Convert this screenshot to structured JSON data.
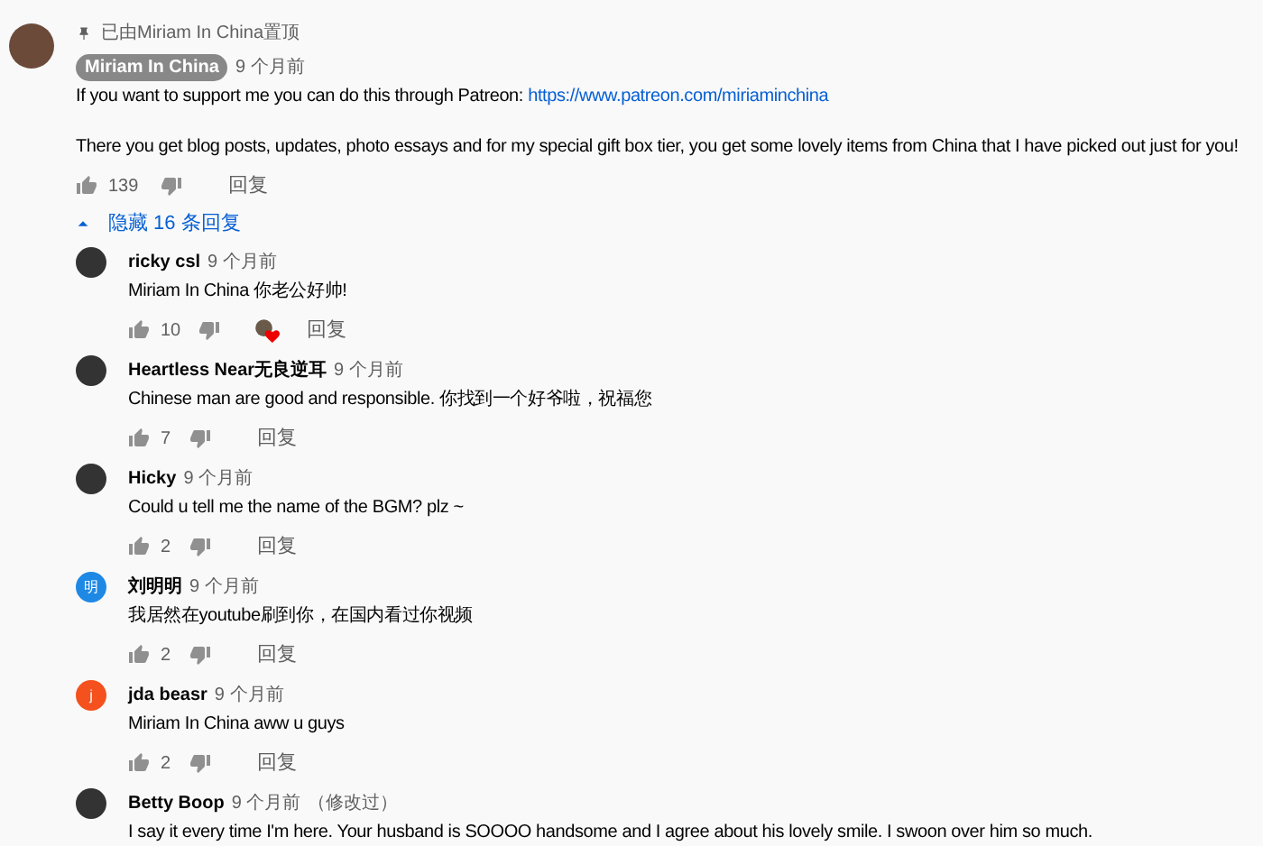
{
  "pinned": {
    "label": "已由Miriam In China置顶"
  },
  "comment": {
    "avatar": {
      "kind": "photo"
    },
    "author": "Miriam In China",
    "author_is_owner": true,
    "time": "9 个月前",
    "paragraphs": [
      {
        "text": "If you want to support me you can do this through Patreon: ",
        "link": "https://www.patreon.com/miriaminchina"
      },
      {
        "text": "There you get blog posts, updates, photo essays and for my special gift box tier, you get some lovely items from China that I have picked out just for you!"
      }
    ],
    "likes": "139",
    "reply_label": "回复"
  },
  "replies_toggle": {
    "label": "隐藏 16 条回复",
    "expanded": true
  },
  "replies": [
    {
      "avatar": {
        "kind": "photo"
      },
      "author": "ricky csl",
      "time": "9 个月前",
      "text": "Miriam In China 你老公好帅!",
      "likes": "10",
      "creator_heart": true,
      "reply_label": "回复"
    },
    {
      "avatar": {
        "kind": "photo"
      },
      "author": "Heartless Near无良逆耳",
      "time": "9 个月前",
      "text": "Chinese man are good and responsible. 你找到一个好爷啦，祝福您",
      "likes": "7",
      "creator_heart": false,
      "reply_label": "回复"
    },
    {
      "avatar": {
        "kind": "photo"
      },
      "author": "Hicky",
      "time": "9 个月前",
      "text": "Could u tell me the name of the BGM? plz ~",
      "likes": "2",
      "creator_heart": false,
      "reply_label": "回复"
    },
    {
      "avatar": {
        "kind": "letter",
        "letter": "明",
        "color": "#1e88e5"
      },
      "author": "刘明明",
      "time": "9 个月前",
      "text": "我居然在youtube刷到你，在国内看过你视频",
      "likes": "2",
      "creator_heart": false,
      "reply_label": "回复"
    },
    {
      "avatar": {
        "kind": "letter",
        "letter": "j",
        "color": "#f4511e"
      },
      "author": "jda beasr",
      "time": "9 个月前",
      "text": "Miriam In China aww u guys",
      "likes": "2",
      "creator_heart": false,
      "reply_label": "回复"
    },
    {
      "avatar": {
        "kind": "photo"
      },
      "author": "Betty Boop",
      "time": "9 个月前",
      "edited": "（修改过）",
      "text": "I say it every time I'm here. Your husband is SOOOO handsome and I agree about his lovely smile. I swoon over him so much."
    }
  ]
}
